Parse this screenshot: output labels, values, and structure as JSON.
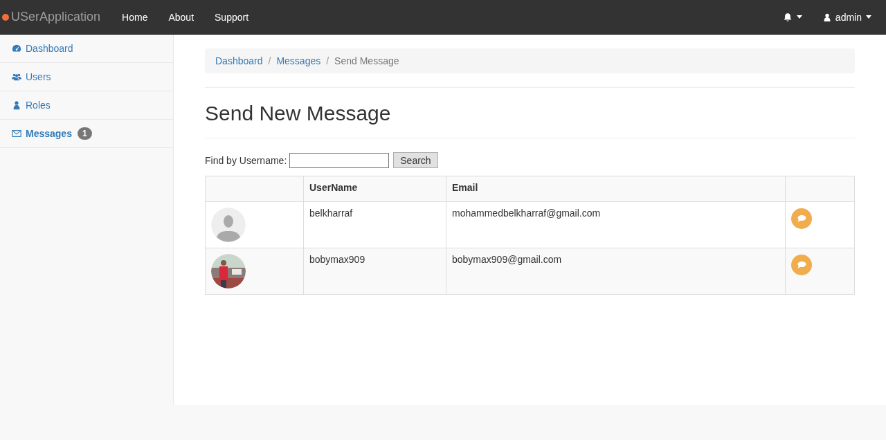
{
  "navbar": {
    "brand": "USerApplication",
    "links": [
      "Home",
      "About",
      "Support"
    ],
    "user": "admin"
  },
  "sidebar": {
    "items": [
      {
        "label": "Dashboard",
        "selected": false
      },
      {
        "label": "Users",
        "selected": false
      },
      {
        "label": "Roles",
        "selected": false
      },
      {
        "label": "Messages",
        "selected": true,
        "badge": "1"
      }
    ]
  },
  "breadcrumb": [
    {
      "label": "Dashboard",
      "link": true
    },
    {
      "separator": "/",
      "label": "Messages",
      "link": true
    },
    {
      "separator": "/",
      "label": "Send Message",
      "link": false
    }
  ],
  "heading": "Send New Message",
  "search": {
    "label": "Find by Username:",
    "button": "Search"
  },
  "table": {
    "columns": [
      "UserName",
      "Email"
    ],
    "rows": [
      {
        "username": "belkharraf",
        "email": "mohammedbelkharraf@gmail.com"
      },
      {
        "kind": "picture",
        "username": "bobymax909",
        "email": "bobymax909@gmail.com"
      }
    ]
  }
}
